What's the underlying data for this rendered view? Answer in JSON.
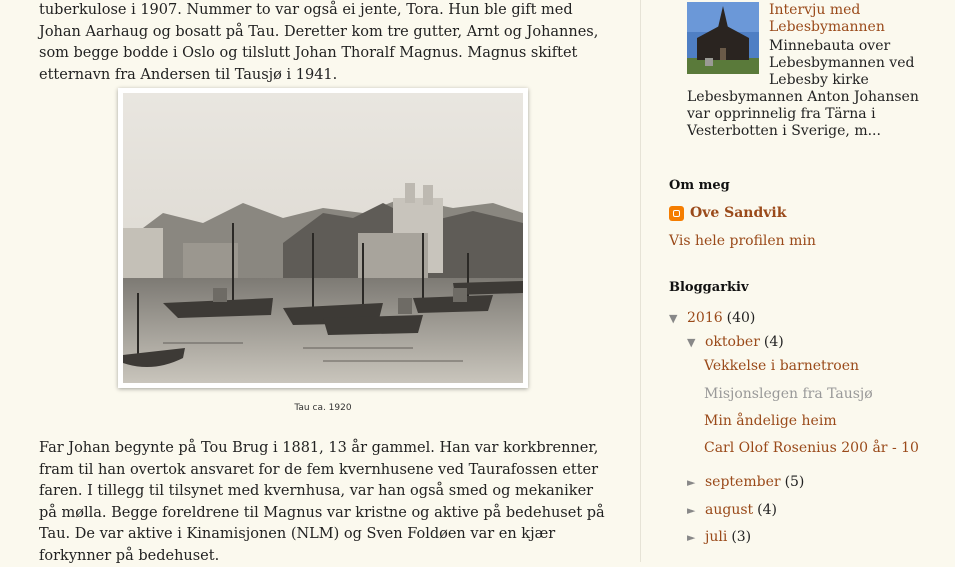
{
  "article": {
    "paragraph1": "tuberkulose i 1907. Nummer to var også ei jente, Tora. Hun ble gift med Johan Aarhaug og bosatt på Tau. Deretter kom tre gutter, Arnt og Johannes, som begge bodde i Oslo og tilslutt Johan Thoralf Magnus. Magnus skiftet etternavn fra Andersen til Tausjø i 1941.",
    "photo_caption": "Tau ca. 1920",
    "paragraph2": "Far Johan begynte på Tou Brug i 1881, 13 år gammel. Han var korkbrenner, fram til han overtok ansvaret for de fem kvernhusene ved Taurafossen etter faren. I tillegg til tilsynet med kvernhusa, var han også smed og mekaniker på mølla. Begge foreldrene til Magnus var kristne og aktive på bedehuset på Tau. De var aktive i Kinamisjonen (NLM) og Sven Foldøen var en kjær forkynner på bedehuset."
  },
  "sidebar": {
    "popular_post": {
      "title": "Intervju med Lebesbymannen",
      "snippet_a": "Minnebauta over Lebesbymannen ved Lebesby kirke",
      "snippet_b": "Lebesbymannen Anton Johansen var opprinnelig fra Tärna i Vesterbotten i Sverige, m..."
    },
    "about": {
      "heading": "Om meg",
      "name": "Ove Sandvik",
      "profile_link": "Vis hele profilen min"
    },
    "archive": {
      "heading": "Bloggarkiv",
      "year": {
        "label": "2016",
        "count": "(40)",
        "toggle": "▼"
      },
      "open_month": {
        "label": "oktober",
        "count": "(4)",
        "toggle": "▼"
      },
      "posts": [
        "Vekkelse i barnetroen",
        "Misjonslegen fra Tausjø",
        "Min åndelige heim",
        "Carl Olof Rosenius 200 år - 10"
      ],
      "months": [
        {
          "label": "september",
          "count": "(5)",
          "toggle": "►"
        },
        {
          "label": "august",
          "count": "(4)",
          "toggle": "►"
        },
        {
          "label": "juli",
          "count": "(3)",
          "toggle": "►"
        }
      ]
    }
  },
  "colors": {
    "link": "#9a4a1a",
    "background": "#fbf9ee",
    "blogger_orange": "#f57d00"
  }
}
